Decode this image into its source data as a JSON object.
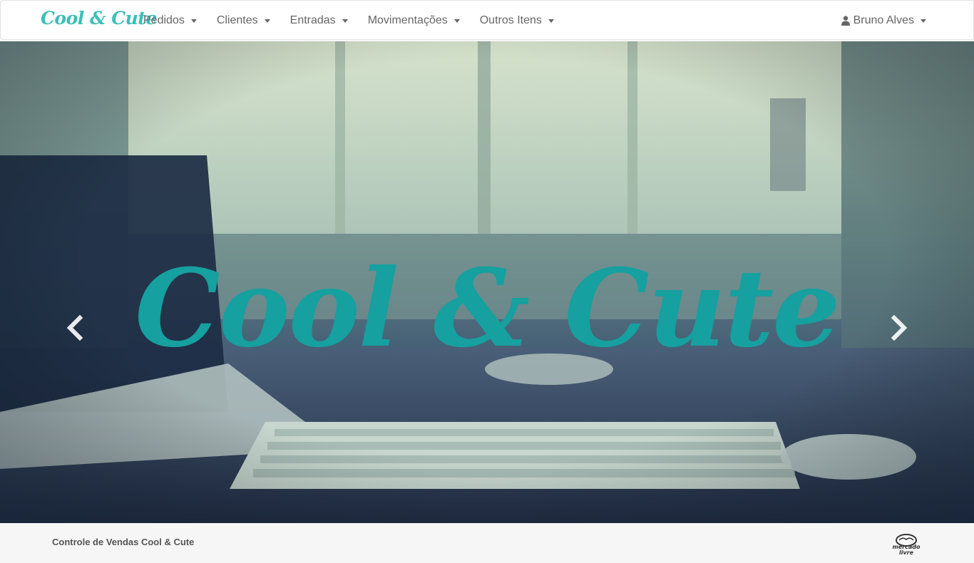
{
  "navbar": {
    "brand": "Cool & Cute",
    "menu": [
      {
        "label": "Pedidos"
      },
      {
        "label": "Clientes"
      },
      {
        "label": "Entradas"
      },
      {
        "label": "Movimentações"
      },
      {
        "label": "Outros Itens"
      }
    ],
    "user": {
      "name": "Bruno Alves",
      "icon": "user-icon"
    }
  },
  "carousel": {
    "headline": "Cool & Cute",
    "prev_icon": "chevron-left-icon",
    "next_icon": "chevron-right-icon",
    "slides_count": 2,
    "active_slide": 1,
    "colors": {
      "headline": "#16a0a0",
      "brand": "#3bbfb8"
    }
  },
  "footer": {
    "text": "Controle de Vendas Cool & Cute",
    "logo_text": "mercado livre"
  }
}
